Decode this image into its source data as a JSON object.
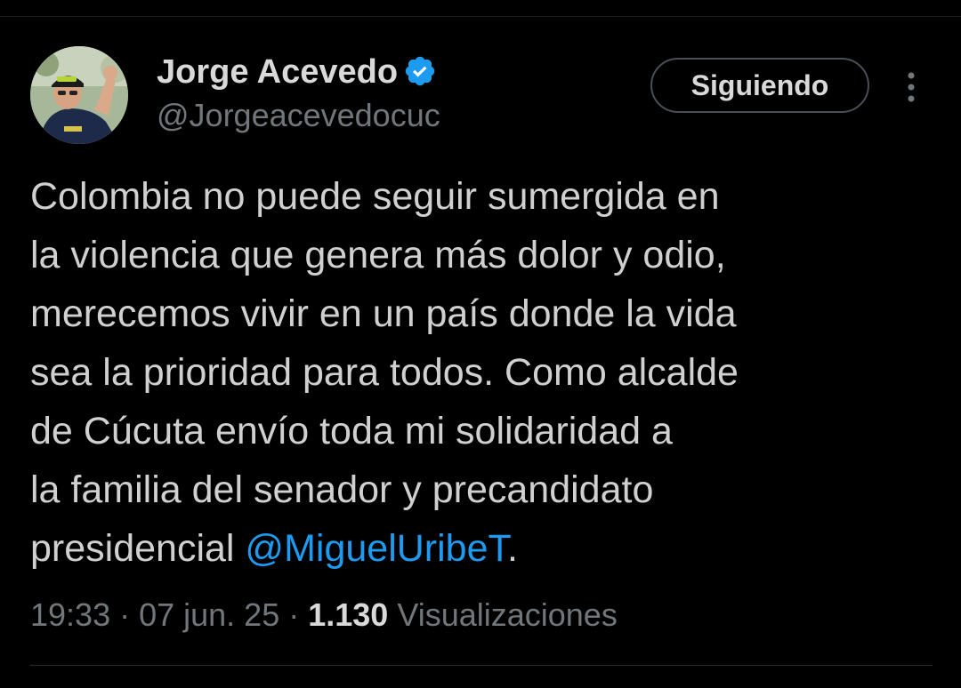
{
  "author": {
    "name": "Jorge Acevedo",
    "handle": "@Jorgeacevedocuc",
    "verified": true,
    "badge_color": "#1d9bf0"
  },
  "follow_button": {
    "label": "Siguiendo"
  },
  "tweet": {
    "lines": [
      "Colombia no puede seguir sumergida en",
      "la violencia que genera más dolor y odio,",
      "merecemos vivir en un país donde la vida",
      "sea la prioridad para todos. Como alcalde",
      "de Cúcuta envío toda mi solidaridad a",
      "la familia del senador y precandidato"
    ],
    "last_line_prefix": "presidencial ",
    "mention": "@MiguelUribeT",
    "last_line_suffix": "."
  },
  "meta": {
    "time": "19:33",
    "separator": " · ",
    "date": "07 jun. 25",
    "views_count": "1.130",
    "views_label": " Visualizaciones"
  },
  "colors": {
    "background": "#000000",
    "text": "#d9d9d9",
    "secondary_text": "#71767b",
    "link": "#1d9bf0"
  },
  "icons": {
    "verified": "verified-badge-icon",
    "more": "more-vertical-icon"
  }
}
